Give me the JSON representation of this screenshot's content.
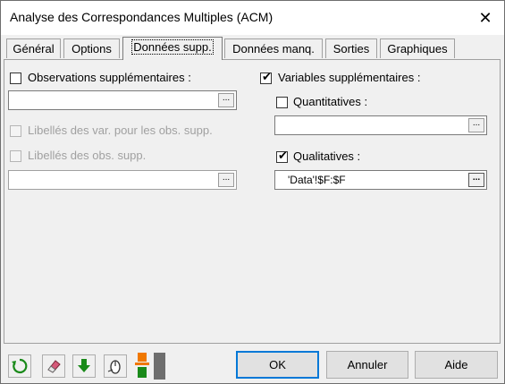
{
  "window": {
    "title": "Analyse des Correspondances Multiples (ACM)",
    "close_glyph": "✕"
  },
  "tabs": [
    {
      "label": "Général"
    },
    {
      "label": "Options"
    },
    {
      "label": "Données supp."
    },
    {
      "label": "Données manq."
    },
    {
      "label": "Sorties"
    },
    {
      "label": "Graphiques"
    }
  ],
  "active_tab": "Données supp.",
  "left": {
    "obs_supp": {
      "label": "Observations supplémentaires :",
      "checked": false,
      "value": ""
    },
    "libelles_var": {
      "label": "Libellés des var. pour les obs. supp.",
      "checked": false,
      "enabled": false
    },
    "libelles_obs": {
      "label": "Libellés des obs. supp.",
      "checked": false,
      "enabled": false,
      "value": ""
    }
  },
  "right": {
    "var_supp": {
      "label": "Variables supplémentaires :",
      "checked": true
    },
    "quantitatives": {
      "label": "Quantitatives :",
      "checked": false,
      "value": ""
    },
    "qualitatives": {
      "label": "Qualitatives :",
      "checked": true,
      "value": "'Data'!$F:$F"
    }
  },
  "range_button_glyph": "...",
  "footer": {
    "ok_label": "OK",
    "cancel_label": "Annuler",
    "help_label": "Aide"
  },
  "icons": [
    "reset-icon",
    "eraser-icon",
    "download-arrow-icon",
    "mouse-select-icon",
    "color-swatch-icon",
    "grey-bar-icon"
  ],
  "colors": {
    "accent": "#0078d7",
    "green": "#1a8a1a",
    "orange": "#f07800"
  }
}
